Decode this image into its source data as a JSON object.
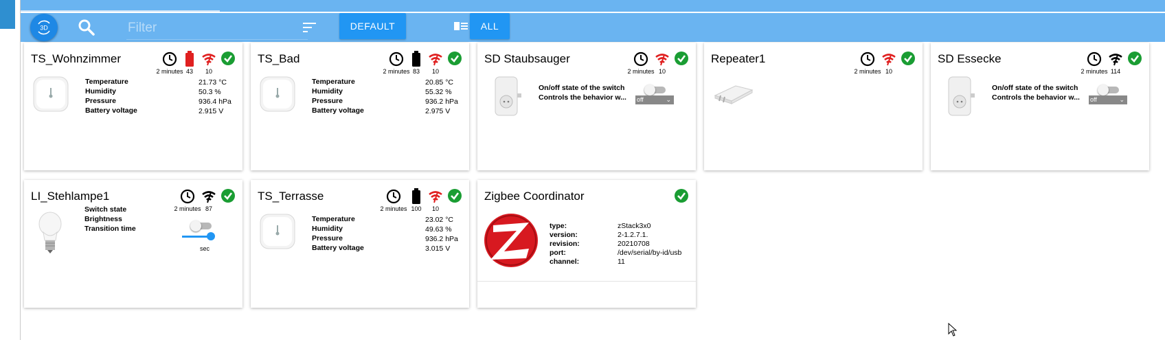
{
  "toolbar": {
    "btn_3d": "3D",
    "filter_placeholder": "Filter",
    "default_label": "DEFAULT",
    "all_label": "ALL"
  },
  "colors": {
    "accent": "#2196f3",
    "bar": "#6ab4f1",
    "ok": "#1a9d33",
    "bad": "#e02020"
  },
  "cards": [
    {
      "title": "TS_Wohnzimmer",
      "time": "2 minutes",
      "battery": "43",
      "lqi": "10",
      "props": [
        "Temperature",
        "Humidity",
        "Pressure",
        "Battery voltage"
      ],
      "values": [
        "21.73 °C",
        "50.3 %",
        "936.4 hPa",
        "2.915 V"
      ]
    },
    {
      "title": "TS_Bad",
      "time": "2 minutes",
      "battery": "83",
      "lqi": "10",
      "props": [
        "Temperature",
        "Humidity",
        "Pressure",
        "Battery voltage"
      ],
      "values": [
        "20.85 °C",
        "55.32 %",
        "936.2 hPa",
        "2.975 V"
      ]
    },
    {
      "title": "SD Staubsauger",
      "time": "2 minutes",
      "lqi": "10",
      "props": [
        "On/off state of the switch",
        "Controls the behavior w..."
      ],
      "select": "off"
    },
    {
      "title": "Repeater1",
      "time": "2 minutes",
      "lqi": "10"
    },
    {
      "title": "SD Essecke",
      "time": "2 minutes",
      "lqi": "114",
      "props": [
        "On/off state of the switch",
        "Controls the behavior w..."
      ],
      "select": "off"
    },
    {
      "title": "LI_Stehlampe1",
      "time": "2 minutes",
      "lqi": "87",
      "props": [
        "Switch state",
        "Brightness",
        "Transition time"
      ],
      "unit": "sec",
      "brightness": 1.0
    },
    {
      "title": "TS_Terrasse",
      "time": "2 minutes",
      "battery": "100",
      "lqi": "10",
      "props": [
        "Temperature",
        "Humidity",
        "Pressure",
        "Battery voltage"
      ],
      "values": [
        "23.02 °C",
        "49.63 %",
        "936.2 hPa",
        "3.015 V"
      ]
    },
    {
      "title": "Zigbee Coordinator",
      "props": [
        "type:",
        "version:",
        "revision:",
        "port:",
        "channel:"
      ],
      "values": [
        "zStack3x0",
        "2-1.2.7.1.",
        "20210708",
        "/dev/serial/by-id/usb",
        "11"
      ]
    }
  ]
}
